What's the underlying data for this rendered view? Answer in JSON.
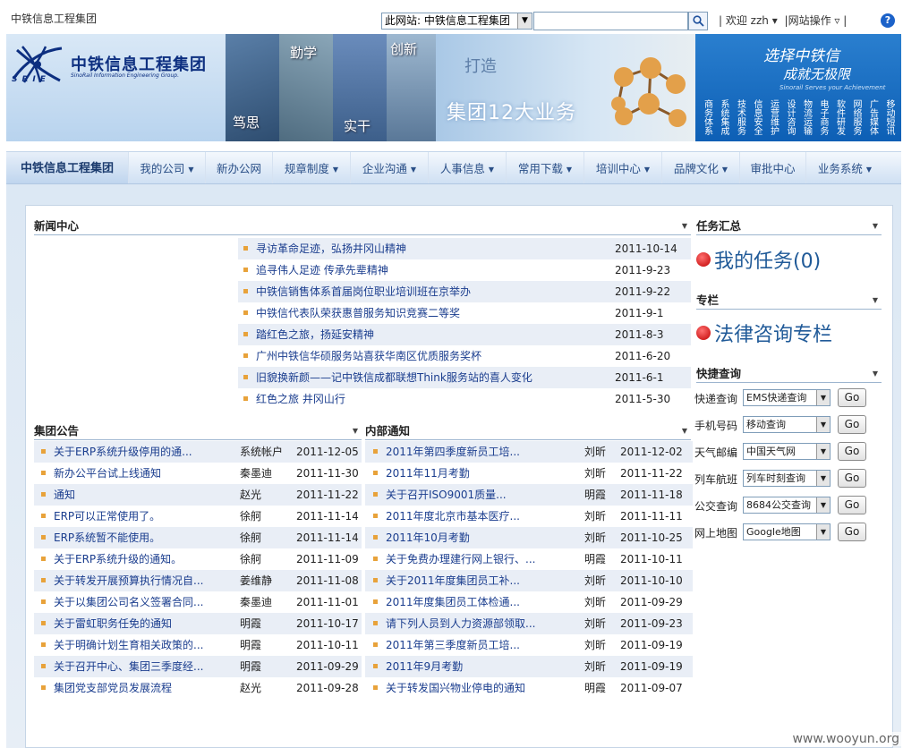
{
  "colors": {
    "accent": "#1a3d8e",
    "bullet": "#e8a23a",
    "nav_text": "#2a4f87",
    "row_alt": "#e9eef6"
  },
  "topbar": {
    "site_title": "中铁信息工程集团",
    "scope_select": "此网站: 中铁信息工程集团",
    "welcome": "| 欢迎 zzh ▾",
    "site_ops": "|网站操作 ▿ |"
  },
  "banner": {
    "logo_cn": "中铁信息工程集团",
    "logo_en": "SinoRail Information Engineering Group.",
    "logo_abbr": "SRIE",
    "photo_words": [
      "勤学",
      "创新",
      "笃思",
      "实干"
    ],
    "dazao": "打造",
    "yewu": "集团12大业务",
    "slogan1": "选择中铁信",
    "slogan2": "成就无极限",
    "slogan_en": "Sinorail Serves your Achievement",
    "business_cols": [
      "商务体系",
      "系统集成",
      "技术服务",
      "信息安全",
      "运营维护",
      "设计咨询",
      "物流运输",
      "电子商务",
      "软件研发",
      "网络服务",
      "广告媒体",
      "移动短讯"
    ]
  },
  "nav": {
    "home": "中铁信息工程集团",
    "items": [
      "我的公司",
      "新办公网",
      "规章制度",
      "企业沟通",
      "人事信息",
      "常用下载",
      "培训中心",
      "品牌文化",
      "审批中心",
      "业务系统"
    ]
  },
  "news": {
    "title": "新闻中心",
    "items": [
      {
        "title": "寻访革命足迹，弘扬井冈山精神",
        "date": "2011-10-14"
      },
      {
        "title": "追寻伟人足迹 传承先辈精神",
        "date": "2011-9-23"
      },
      {
        "title": "中铁信销售体系首届岗位职业培训班在京举办",
        "date": "2011-9-22"
      },
      {
        "title": "中铁信代表队荣获惠普服务知识竞赛二等奖",
        "date": "2011-9-1"
      },
      {
        "title": "踏红色之旅，扬延安精神",
        "date": "2011-8-3"
      },
      {
        "title": "广州中铁信华硕服务站喜获华南区优质服务奖杯",
        "date": "2011-6-20"
      },
      {
        "title": "旧貌换新颜——记中铁信成都联想Think服务站的喜人变化",
        "date": "2011-6-1"
      },
      {
        "title": "红色之旅 井冈山行",
        "date": "2011-5-30"
      }
    ]
  },
  "announce": {
    "title": "集团公告",
    "items": [
      {
        "title": "关于ERP系统升级停用的通...",
        "author": "系统帐户",
        "date": "2011-12-05"
      },
      {
        "title": "新办公平台试上线通知",
        "author": "秦墨迪",
        "date": "2011-11-30"
      },
      {
        "title": "通知",
        "author": "赵光",
        "date": "2011-11-22"
      },
      {
        "title": "ERP可以正常使用了。",
        "author": "徐舸",
        "date": "2011-11-14"
      },
      {
        "title": "ERP系统暂不能使用。",
        "author": "徐舸",
        "date": "2011-11-14"
      },
      {
        "title": "关于ERP系统升级的通知。",
        "author": "徐舸",
        "date": "2011-11-09"
      },
      {
        "title": "关于转发开展预算执行情况自...",
        "author": "姜维静",
        "date": "2011-11-08"
      },
      {
        "title": "关于以集团公司名义签署合同...",
        "author": "秦墨迪",
        "date": "2011-11-01"
      },
      {
        "title": "关于雷虹职务任免的通知",
        "author": "明霞",
        "date": "2011-10-17"
      },
      {
        "title": "关于明确计划生育相关政策的...",
        "author": "明霞",
        "date": "2011-10-11"
      },
      {
        "title": "关于召开中心、集团三季度经...",
        "author": "明霞",
        "date": "2011-09-29"
      },
      {
        "title": "集团党支部党员发展流程",
        "author": "赵光",
        "date": "2011-09-28"
      }
    ]
  },
  "internal": {
    "title": "内部通知",
    "items": [
      {
        "title": "2011年第四季度新员工培...",
        "author": "刘昕",
        "date": "2011-12-02"
      },
      {
        "title": "2011年11月考勤",
        "author": "刘昕",
        "date": "2011-11-22"
      },
      {
        "title": "关于召开ISO9001质量...",
        "author": "明霞",
        "date": "2011-11-18"
      },
      {
        "title": "2011年度北京市基本医疗...",
        "author": "刘昕",
        "date": "2011-11-11"
      },
      {
        "title": "2011年10月考勤",
        "author": "刘昕",
        "date": "2011-10-25"
      },
      {
        "title": "关于免费办理建行网上银行、...",
        "author": "明霞",
        "date": "2011-10-11"
      },
      {
        "title": "关于2011年度集团员工补...",
        "author": "刘昕",
        "date": "2011-10-10"
      },
      {
        "title": "2011年度集团员工体检通...",
        "author": "刘昕",
        "date": "2011-09-29"
      },
      {
        "title": "请下列人员到人力资源部领取...",
        "author": "刘昕",
        "date": "2011-09-23"
      },
      {
        "title": "2011年第三季度新员工培...",
        "author": "刘昕",
        "date": "2011-09-19"
      },
      {
        "title": "2011年9月考勤",
        "author": "刘昕",
        "date": "2011-09-19"
      },
      {
        "title": "关于转发国兴物业停电的通知",
        "author": "明霞",
        "date": "2011-09-07"
      }
    ]
  },
  "tasks": {
    "title": "任务汇总",
    "link": "我的任务(0)"
  },
  "column": {
    "title": "专栏",
    "link": "法律咨询专栏"
  },
  "quick": {
    "title": "快捷查询",
    "go": "Go",
    "rows": [
      {
        "label": "快递查询",
        "option": "EMS快递查询"
      },
      {
        "label": "手机号码",
        "option": "移动查询"
      },
      {
        "label": "天气邮编",
        "option": "中国天气网"
      },
      {
        "label": "列车航班",
        "option": "列车时刻查询"
      },
      {
        "label": "公交查询",
        "option": "8684公交查询"
      },
      {
        "label": "网上地图",
        "option": "Google地图"
      }
    ]
  },
  "watermark": "www.wooyun.org"
}
